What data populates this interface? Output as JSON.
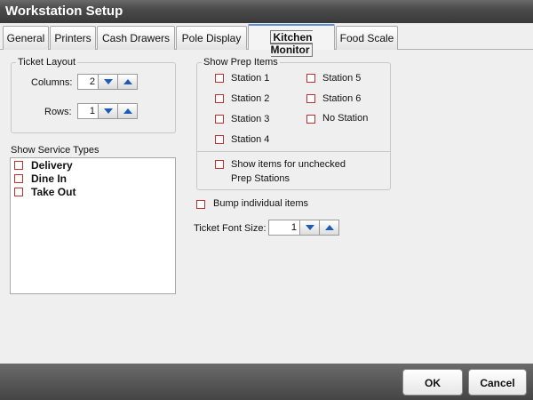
{
  "window": {
    "title": "Workstation Setup"
  },
  "tabs": [
    {
      "label": "General"
    },
    {
      "label": "Printers"
    },
    {
      "label": "Cash Drawers"
    },
    {
      "label": "Pole Display"
    },
    {
      "label": "Kitchen Monitor"
    },
    {
      "label": "Food Scale"
    }
  ],
  "active_tab": "Kitchen Monitor",
  "ticket_layout": {
    "legend": "Ticket Layout",
    "columns_label": "Columns:",
    "columns_value": "2",
    "rows_label": "Rows:",
    "rows_value": "1"
  },
  "service_types": {
    "legend": "Show Service Types",
    "items": [
      {
        "label": "Delivery",
        "checked": false
      },
      {
        "label": "Dine In",
        "checked": false
      },
      {
        "label": "Take Out",
        "checked": false
      }
    ]
  },
  "prep_items": {
    "legend": "Show Prep Items",
    "stations": [
      {
        "label": "Station 1"
      },
      {
        "label": "Station 2"
      },
      {
        "label": "Station 3"
      },
      {
        "label": "Station 4"
      },
      {
        "label": "Station 5"
      },
      {
        "label": "Station 6"
      },
      {
        "label": "No Station"
      }
    ],
    "unchecked_line1": "Show items for unchecked",
    "unchecked_line2": "Prep Stations"
  },
  "bump": {
    "label": "Bump individual items"
  },
  "font_size": {
    "label": "Ticket Font Size:",
    "value": "1"
  },
  "footer": {
    "ok_label": "OK",
    "cancel_label": "Cancel"
  },
  "colors": {
    "checkbox_border": "#c03030",
    "spin_arrow": "#1e5ab8",
    "active_tab_accent": "#5b8fd6"
  }
}
